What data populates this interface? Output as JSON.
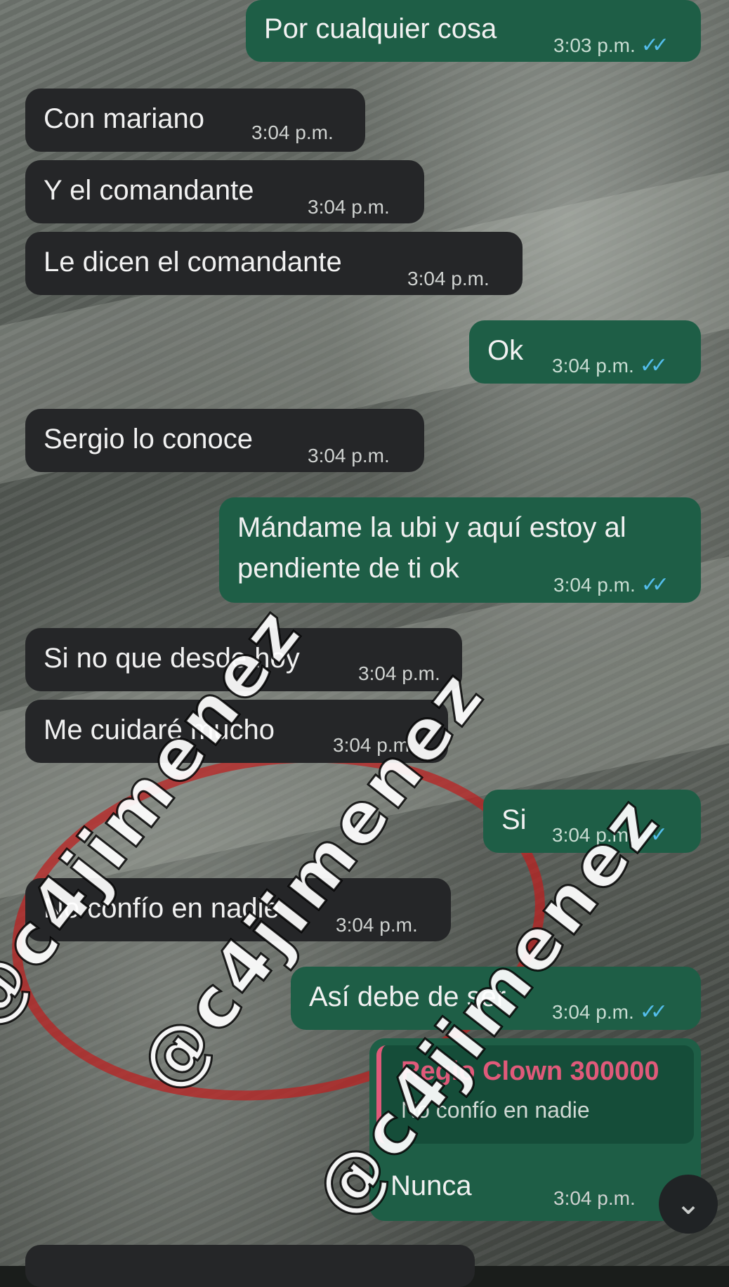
{
  "messages": [
    {
      "type": "out",
      "text": "Por cualquier cosa",
      "time": "3:03 p.m.",
      "ticks": "✓✓"
    },
    {
      "type": "in",
      "text": "Con mariano",
      "time": "3:04 p.m."
    },
    {
      "type": "in",
      "text": "Y el comandante",
      "time": "3:04 p.m."
    },
    {
      "type": "in",
      "text": "Le dicen el comandante",
      "time": "3:04 p.m."
    },
    {
      "type": "out",
      "text": "Ok",
      "time": "3:04 p.m.",
      "ticks": "✓✓"
    },
    {
      "type": "in",
      "text": "Sergio lo conoce",
      "time": "3:04 p.m."
    },
    {
      "type": "out",
      "text_line1": "Mándame la ubi y aquí estoy al",
      "text_line2": "pendiente de ti ok",
      "time": "3:04 p.m.",
      "ticks": "✓✓"
    },
    {
      "type": "in",
      "text": "Si no que desde hoy",
      "time": "3:04 p.m."
    },
    {
      "type": "in",
      "text": "Me cuidaré mucho",
      "time": "3:04 p.m."
    },
    {
      "type": "out",
      "text": "Si",
      "time": "3:04 p.m.",
      "ticks": "✓✓"
    },
    {
      "type": "in",
      "text": "No confío en nadie",
      "time": "3:04 p.m."
    },
    {
      "type": "out",
      "text": "Así debe de ser",
      "time": "3:04 p.m.",
      "ticks": "✓✓"
    },
    {
      "type": "out",
      "quote_author": "Regio Clown 300000",
      "quote_text": "No confío en nadie",
      "text": "Nunca",
      "time": "3:04 p.m."
    }
  ],
  "watermark": "@c4jimenez",
  "colors": {
    "outgoing": "#1e5e46",
    "incoming": "#252628",
    "quote_author": "#e05a7a",
    "read_ticks": "#53bdeb",
    "annotation_circle": "#be1e1e"
  },
  "icons": {
    "scroll": "chevron-down-icon",
    "read": "double-check-icon"
  }
}
